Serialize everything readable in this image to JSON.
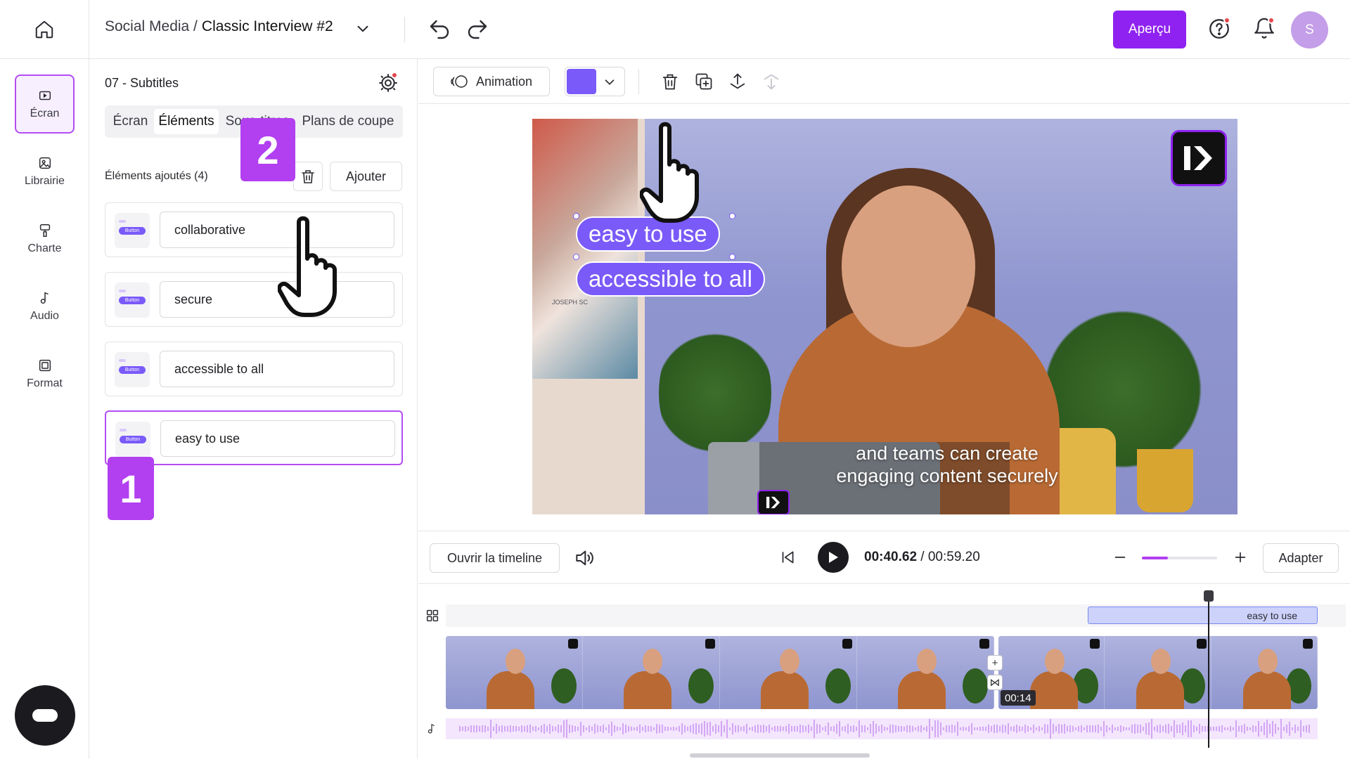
{
  "header": {
    "breadcrumb_parent": "Social Media /",
    "breadcrumb_current": "Classic Interview #2",
    "preview_label": "Aperçu",
    "avatar_initial": "S"
  },
  "nav": {
    "items": [
      {
        "label": "Écran",
        "icon": "screen-icon",
        "active": true
      },
      {
        "label": "Librairie",
        "icon": "library-icon",
        "active": false
      },
      {
        "label": "Charte",
        "icon": "brand-charter-icon",
        "active": false
      },
      {
        "label": "Audio",
        "icon": "music-note-icon",
        "active": false
      },
      {
        "label": "Format",
        "icon": "format-icon",
        "active": false
      }
    ]
  },
  "panel": {
    "title": "07 - Subtitles",
    "tabs": [
      {
        "label": "Écran",
        "active": false
      },
      {
        "label": "Éléments",
        "active": true
      },
      {
        "label": "Sous-titres",
        "active": false
      },
      {
        "label": "Plans de coupe",
        "active": false
      }
    ],
    "added_label": "Éléments ajoutés (4)",
    "add_label": "Ajouter",
    "thumb_label": "Button",
    "elements": [
      {
        "value": "collaborative",
        "selected": false
      },
      {
        "value": "secure",
        "selected": false
      },
      {
        "value": "accessible to all",
        "selected": false
      },
      {
        "value": "easy to use",
        "selected": true
      }
    ]
  },
  "steps": {
    "one": "1",
    "two": "2"
  },
  "toolbar": {
    "animation_label": "Animation",
    "accent_color": "#7a5af8"
  },
  "video": {
    "pill_1": "easy to use",
    "pill_2": "accessible to all",
    "subtitle_line_1": "and teams can create",
    "subtitle_line_2": "engaging content securely",
    "poster_text": "JOSEPH SC"
  },
  "playback": {
    "timeline_label": "Ouvrir la timeline",
    "current_time": "00:40.62",
    "separator": " / ",
    "total_time": "00:59.20",
    "zoom_level": 0.35,
    "fit_label": "Adapter"
  },
  "timeline": {
    "subtitle_block": "easy to use",
    "clip_time": "00:14"
  },
  "colors": {
    "brand_purple": "#8f22f0",
    "step_badge": "#b23ff0",
    "element_purple": "#7a5af8"
  }
}
